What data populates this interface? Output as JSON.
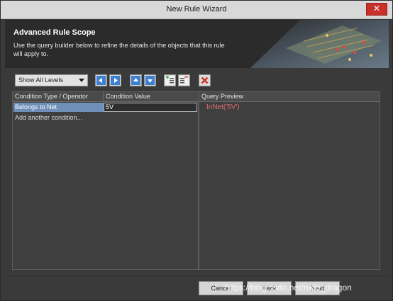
{
  "window": {
    "title": "New Rule Wizard",
    "close_glyph": "✕"
  },
  "header": {
    "title": "Advanced Rule Scope",
    "description": "Use the query builder below to refine the details of the objects that this rule will apply to."
  },
  "toolbar": {
    "levels_select": "Show All Levels",
    "icons": [
      "arrow-left-icon",
      "arrow-right-icon",
      "arrow-up-icon",
      "arrow-down-icon",
      "add-condition-icon",
      "remove-condition-icon",
      "delete-icon"
    ]
  },
  "grid": {
    "columns": [
      "Condition Type / Operator",
      "Condition Value"
    ],
    "rows": [
      {
        "type": "Belongs to Net",
        "value": "5V"
      }
    ],
    "add_label": "Add another condition..."
  },
  "preview": {
    "header": "Query Preview",
    "query": "InNet('5V')"
  },
  "footer": {
    "cancel_label": "Cancel",
    "back_label": "Back",
    "next_label": "Next"
  },
  "watermark": "https://blog.csdn.net/rude_dragon",
  "colors": {
    "query_text": "#e06c6c",
    "selection": "#6f8fb8",
    "close_button": "#c8302a"
  }
}
